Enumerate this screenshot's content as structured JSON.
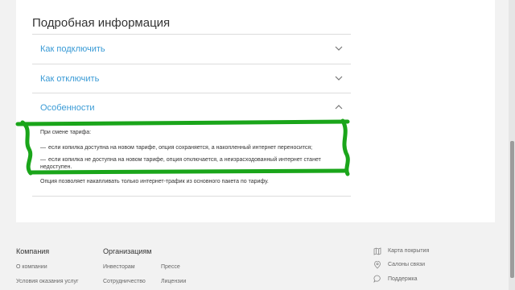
{
  "details": {
    "title": "Подробная информация",
    "items": [
      {
        "label": "Как подключить",
        "state": "collapsed"
      },
      {
        "label": "Как отключить",
        "state": "collapsed"
      },
      {
        "label": "Особенности",
        "state": "expanded"
      }
    ],
    "content": {
      "intro": "При смене тарифа:",
      "bullets": [
        "если копилка доступна на новом тарифе, опция сохраняется, а накопленный интернет переносится;",
        "если копилка не доступна на новом тарифе, опция отключается, а неизрасходованный интернет станет недоступен."
      ],
      "note": "Опция позволяет накапливать только интернет-трафик из основного пакета по тарифу.",
      "bullet_marker": "—"
    }
  },
  "annotation": {
    "color": "#1aa51a"
  },
  "colors": {
    "link": "#3a9bd6",
    "page_bg": "#f2f2f2",
    "card_bg": "#ffffff"
  },
  "footer": {
    "company": {
      "title": "Компания",
      "links": [
        "О компании",
        "Условия оказания услуг"
      ]
    },
    "organizations": {
      "title": "Организациям",
      "links_col1": [
        "Инвесторам",
        "Сотрудничество"
      ],
      "links_col2": [
        "Прессе",
        "Лицензии"
      ]
    },
    "right_links": [
      {
        "icon": "map-icon",
        "label": "Карта покрытия"
      },
      {
        "icon": "location-pin-icon",
        "label": "Салоны связи"
      },
      {
        "icon": "chat-icon",
        "label": "Поддержка"
      }
    ]
  }
}
